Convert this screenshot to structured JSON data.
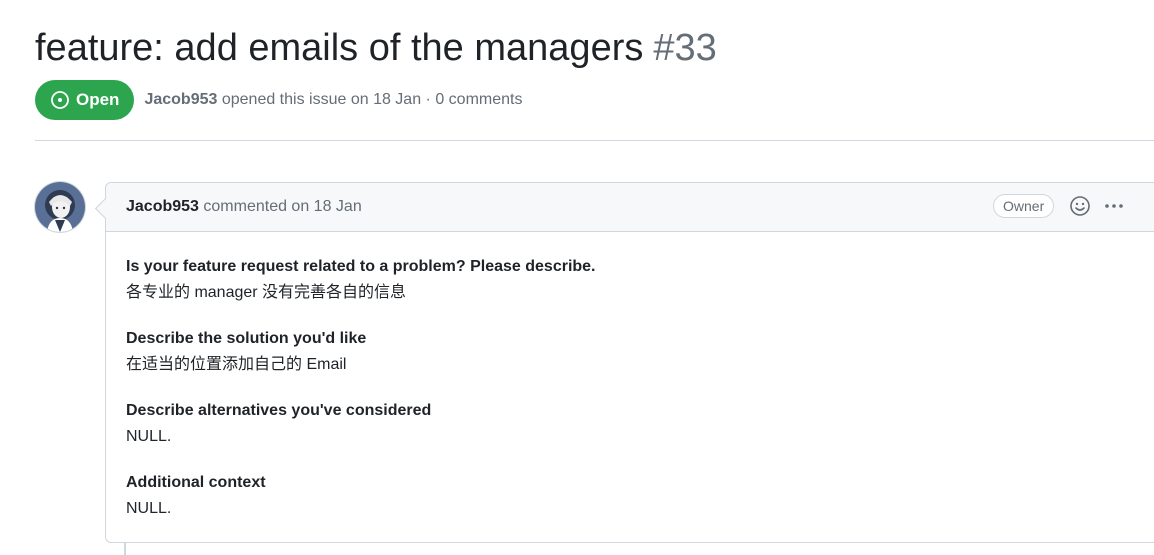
{
  "issue": {
    "title": "feature: add emails of the managers",
    "number": "#33",
    "state": "Open",
    "author": "Jacob953",
    "meta_suffix": "opened this issue on 18 Jan · 0 comments"
  },
  "comment": {
    "author": "Jacob953",
    "action": "commented on 18 Jan",
    "role_badge": "Owner",
    "sections": [
      {
        "heading": "Is your feature request related to a problem? Please describe.",
        "text": "各专业的 manager 没有完善各自的信息"
      },
      {
        "heading": "Describe the solution you'd like",
        "text": "在适当的位置添加自己的 Email"
      },
      {
        "heading": "Describe alternatives you've considered",
        "text": "NULL."
      },
      {
        "heading": "Additional context",
        "text": "NULL."
      }
    ]
  },
  "icons": {
    "state": "issue-opened-icon",
    "reaction": "smiley-icon",
    "menu": "kebab-horizontal-icon",
    "avatar": "user-avatar"
  },
  "colors": {
    "open_green": "#2da44e",
    "muted_text": "#656d76",
    "border": "#d0d7de",
    "header_bg": "#f6f8fa"
  }
}
